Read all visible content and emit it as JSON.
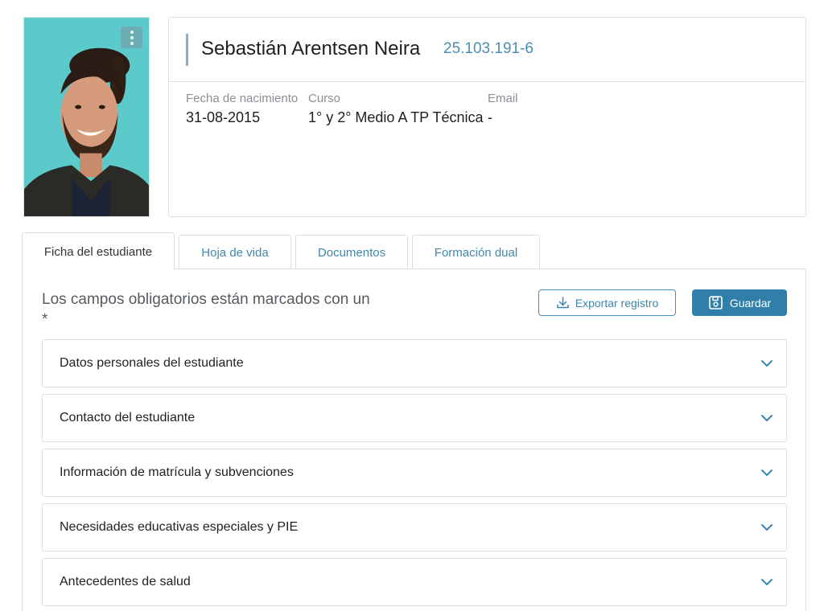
{
  "student": {
    "name": "Sebastián Arentsen Neira",
    "rut": "25.103.191-6",
    "fields": [
      {
        "label": "Fecha de nacimiento",
        "value": "31-08-2015"
      },
      {
        "label": "Curso",
        "value": "1° y 2° Medio A TP Técnica"
      },
      {
        "label": "Email",
        "value": "-"
      }
    ]
  },
  "tabs": [
    {
      "label": "Ficha del estudiante",
      "active": true
    },
    {
      "label": "Hoja de vida",
      "active": false
    },
    {
      "label": "Documentos",
      "active": false
    },
    {
      "label": "Formación dual",
      "active": false
    }
  ],
  "panel": {
    "required_note": "Los campos obligatorios están marcados con un *",
    "export_label": "Exportar registro",
    "save_label": "Guardar"
  },
  "sections": [
    {
      "title": "Datos personales del estudiante"
    },
    {
      "title": "Contacto del estudiante"
    },
    {
      "title": "Información de matrícula y subvenciones"
    },
    {
      "title": "Necesidades educativas especiales y PIE"
    },
    {
      "title": "Antecedentes de salud"
    }
  ],
  "icons": {
    "photo_menu": "kebab-menu-icon",
    "export": "download-icon",
    "save": "save-icon",
    "section_toggle": "chevron-down-icon"
  },
  "colors": {
    "accent": "#2f7fa9",
    "link": "#3f88ad",
    "photo_background": "#5cc9c9"
  }
}
